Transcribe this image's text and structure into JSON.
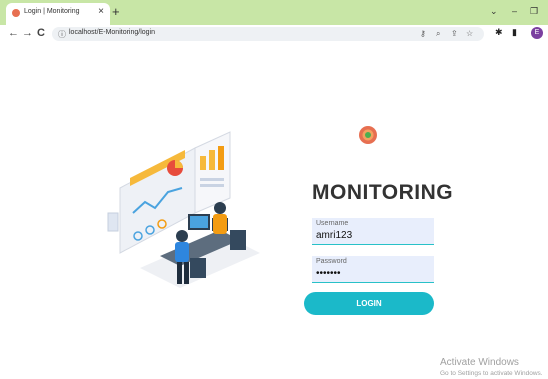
{
  "browser": {
    "tab_title": "Login | Monitoring",
    "tab_close": "×",
    "new_tab": "+",
    "url": "localhost/E-Monitoring/login",
    "nav": {
      "back": "←",
      "forward": "→",
      "reload": "C"
    },
    "window": {
      "collapse": "⌄",
      "minimize": "–",
      "restore": "❐"
    },
    "profile_initial": "E"
  },
  "login": {
    "heading": "MONITORING",
    "username_label": "Username",
    "username_value": "amri123",
    "password_label": "Password",
    "password_value": "•••••••",
    "button_label": "LOGIN"
  },
  "watermark": {
    "title": "Activate Windows",
    "subtitle": "Go to Settings to activate Windows."
  },
  "colors": {
    "tab_strip": "#c8e6a6",
    "accent": "#1bb9c9",
    "field_bg": "#e8eefc",
    "heading": "#333333"
  }
}
